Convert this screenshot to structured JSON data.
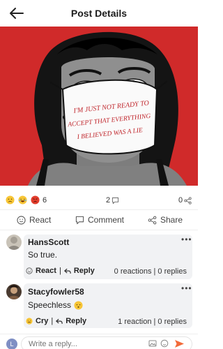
{
  "header": {
    "title": "Post Details"
  },
  "post": {
    "image_text": [
      "I'M JUST NOT READY TO",
      "ACCEPT THAT EVERYTHING",
      "I BELIEVED WAS A LIE"
    ],
    "reactions_count": "6",
    "comments_count": "2",
    "shares_count": "0"
  },
  "actions": {
    "react": "React",
    "comment": "Comment",
    "share": "Share"
  },
  "comments": [
    {
      "name": "HansScott",
      "text": "So true.",
      "reaction_label": "React",
      "reply_label": "Reply",
      "stats": "0 reactions | 0 replies"
    },
    {
      "name": "Stacyfowler58",
      "text": "Speechless",
      "reaction_label": "Cry",
      "reply_label": "Reply",
      "stats": "1 reaction | 0 replies"
    }
  ],
  "reply_input": {
    "placeholder": "Write a reply...",
    "avatar_letter": "L"
  },
  "colors": {
    "accent": "#f26b3a",
    "background_red": "#d02a2a",
    "text_red": "#c0262c"
  }
}
